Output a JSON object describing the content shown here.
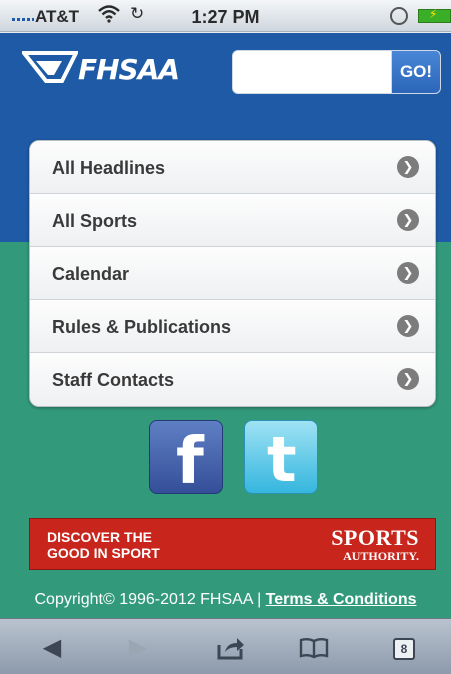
{
  "status_bar": {
    "carrier": "AT&T",
    "time": "1:27 PM",
    "icons": [
      "signal-icon",
      "wifi-icon",
      "sync-icon",
      "rotation-lock-icon",
      "battery-icon"
    ]
  },
  "header": {
    "logo_text": "FHSAA",
    "search_placeholder": "",
    "search_button": "GO!",
    "bg_color": "#1e5aa6"
  },
  "menu": {
    "items": [
      {
        "label": "All Headlines"
      },
      {
        "label": "All Sports"
      },
      {
        "label": "Calendar"
      },
      {
        "label": "Rules & Publications"
      },
      {
        "label": "Staff Contacts"
      }
    ]
  },
  "social": {
    "facebook_glyph": "f",
    "twitter_glyph": "t"
  },
  "banner": {
    "tagline_line1": "DISCOVER THE",
    "tagline_line2": "GOOD IN SPORT",
    "brand_line1": "SPORTS",
    "brand_line2": "AUTHORITY.",
    "color": "#c8261d"
  },
  "footer": {
    "copyright": "Copyright© 1996-2012 FHSAA | ",
    "terms_link": "Terms & Conditions"
  },
  "toolbar": {
    "back_icon": "◀",
    "forward_icon": "▶",
    "share_icon": "⇗",
    "bookmarks_icon": "📖",
    "pages_count": "8"
  },
  "colors": {
    "green_band": "#329a7a"
  }
}
